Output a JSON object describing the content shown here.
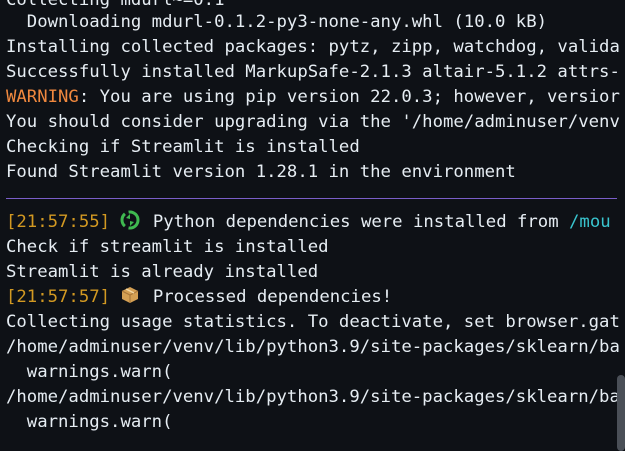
{
  "terminal": {
    "lines": [
      "Collecting mdurl~=0.1",
      "  Downloading mdurl-0.1.2-py3-none-any.whl (10.0 kB)",
      "Installing collected packages: pytz, zipp, watchdog, valida",
      "Successfully installed MarkupSafe-2.1.3 altair-5.1.2 attrs-",
      "You should consider upgrading via the '/home/adminuser/venv",
      "Checking if Streamlit is installed",
      "Found Streamlit version 1.28.1 in the environment"
    ],
    "warning_label": "WARNING",
    "warning_text": ": You are using pip version 22.0.3; however, versior",
    "deps_installed": {
      "timestamp": "[21:57:55]",
      "icon": "recycle-icon",
      "message": " Python dependencies were installed from ",
      "path": "/mou"
    },
    "check_line": "Check if streamlit is installed",
    "already_line": "Streamlit is already installed",
    "processed": {
      "timestamp": "[21:57:57]",
      "icon": "package-icon",
      "message": " Processed dependencies!"
    },
    "tail_lines": [
      "Collecting usage statistics. To deactivate, set browser.gat",
      "/home/adminuser/venv/lib/python3.9/site-packages/sklearn/ba",
      "  warnings.warn(",
      "/home/adminuser/venv/lib/python3.9/site-packages/sklearn/ba",
      "  warnings.warn("
    ],
    "colors": {
      "background": "#0e1116",
      "text": "#e6edf3",
      "warning": "#f0883e",
      "timestamp": "#d29922",
      "path": "#39c5cf",
      "divider": "#7a5ec9"
    }
  }
}
